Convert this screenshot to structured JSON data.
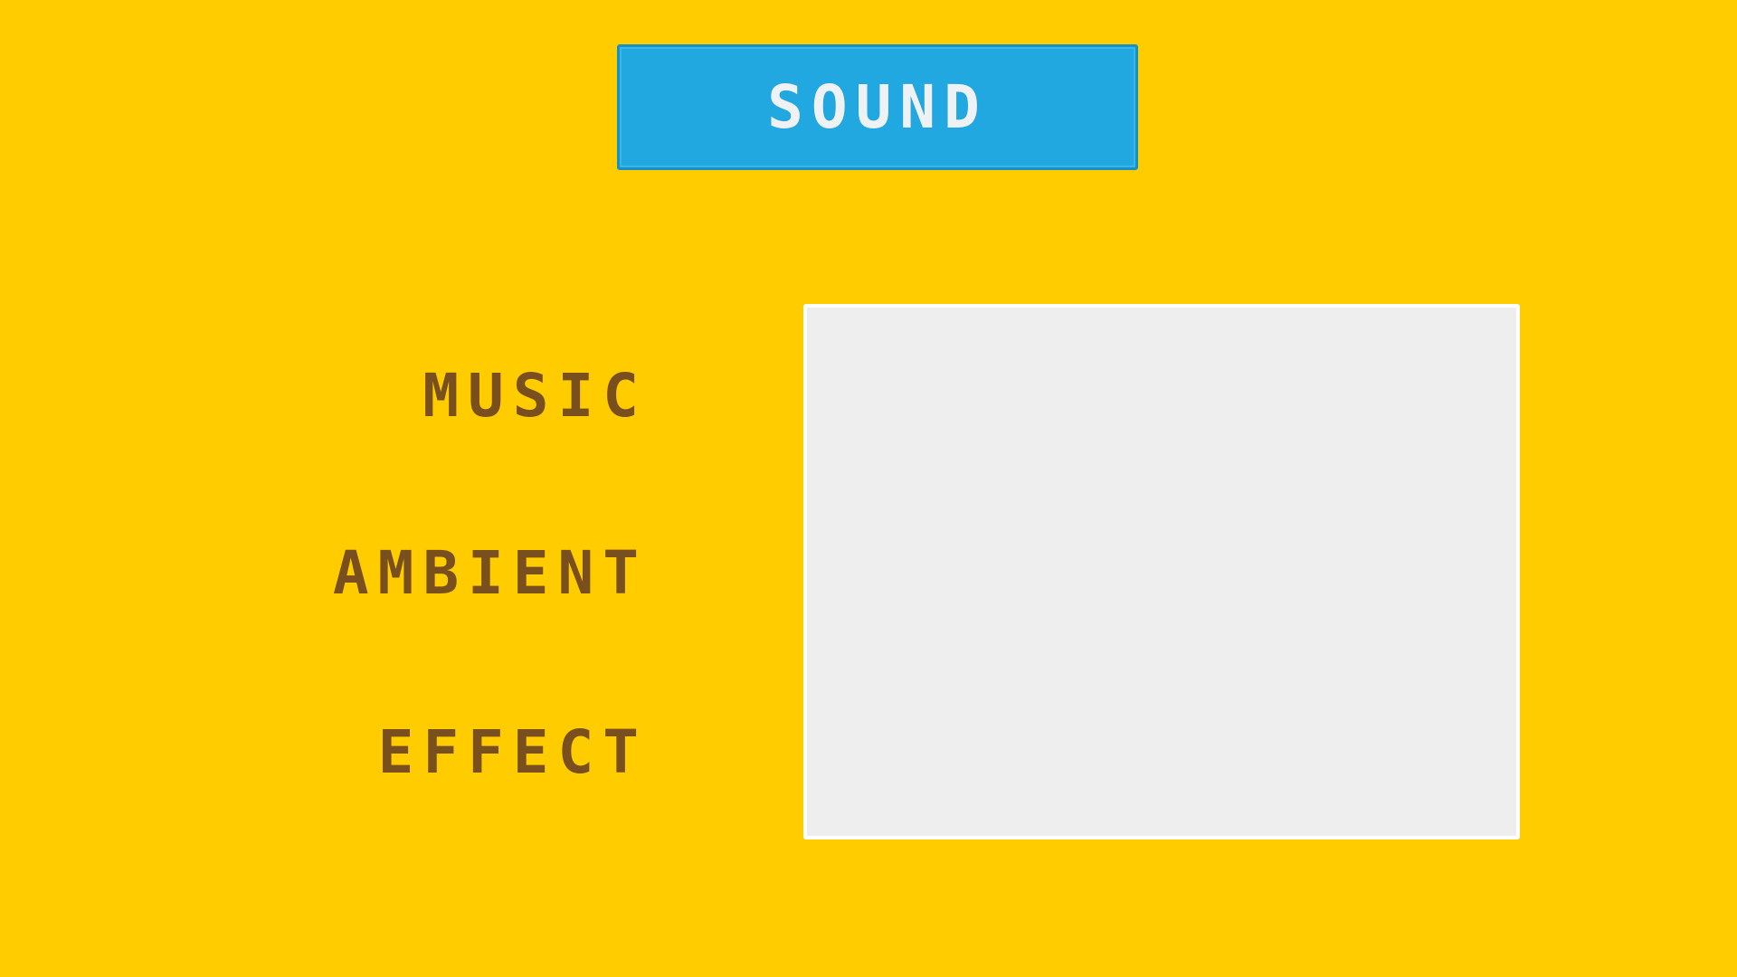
{
  "screen": {
    "title": "SOUND"
  },
  "settings": {
    "music_label": "MUSIC",
    "ambient_label": "AMBIENT",
    "effect_label": "EFFECT"
  },
  "colors": {
    "background": "#FFCC00",
    "title_banner": "#22A8E0",
    "title_text": "#EEF2F5",
    "label_text": "#7A4F1E",
    "panel": "#EEEEEE",
    "panel_border": "#FFFFFF"
  }
}
